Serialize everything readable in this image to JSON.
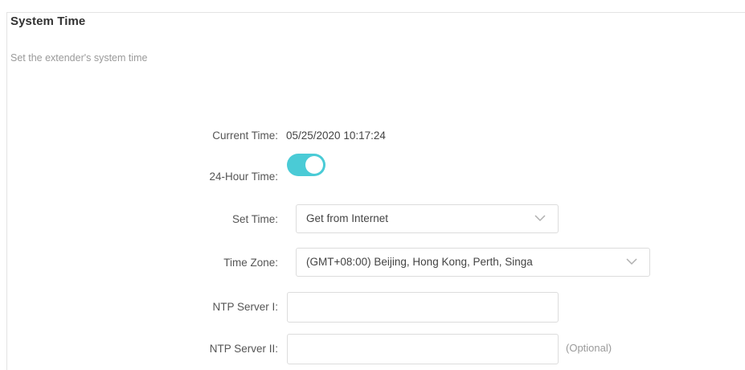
{
  "section": {
    "title": "System Time",
    "subtitle": "Set the extender's system time"
  },
  "current_time": {
    "label": "Current Time:",
    "value": "05/25/2020 10:17:24"
  },
  "hour24": {
    "label": "24-Hour Time:",
    "enabled": true
  },
  "set_time": {
    "label": "Set Time:",
    "selected": "Get from Internet"
  },
  "time_zone": {
    "label": "Time Zone:",
    "selected": "(GMT+08:00) Beijing, Hong Kong, Perth, Singa"
  },
  "ntp1": {
    "label": "NTP Server I:",
    "value": ""
  },
  "ntp2": {
    "label": "NTP Server II:",
    "value": "",
    "hint": "(Optional)"
  },
  "colors": {
    "toggle_on": "#4acbd6",
    "border": "#dcdcdc"
  },
  "icons": {
    "dropdown": "chevron-down-icon"
  }
}
